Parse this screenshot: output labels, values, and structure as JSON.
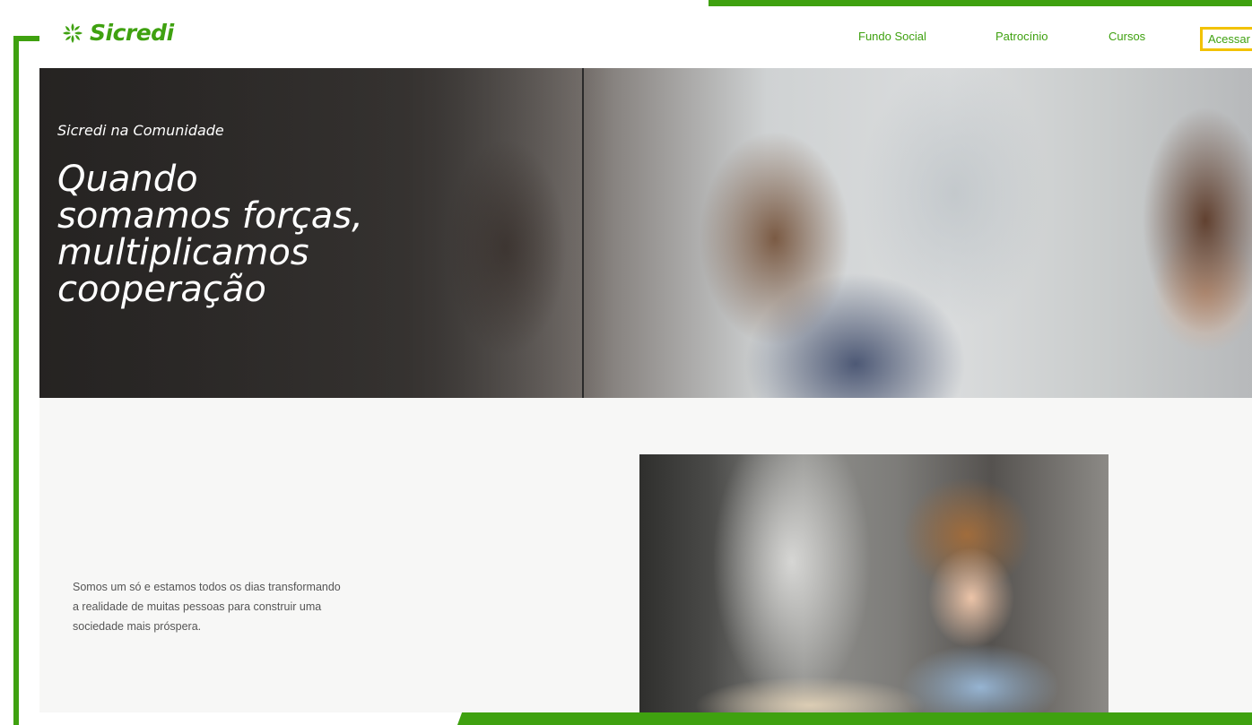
{
  "brand": {
    "name": "Sicredi",
    "color": "#3fa110"
  },
  "nav": {
    "items": [
      {
        "label": "Fundo Social"
      },
      {
        "label": "Patrocínio"
      },
      {
        "label": "Cursos"
      },
      {
        "label": "Acessar"
      }
    ]
  },
  "hero": {
    "eyebrow": "Sicredi na Comunidade",
    "title_lines": [
      "Quando",
      "somamos forças,",
      "multiplicamos",
      "cooperação"
    ]
  },
  "intro": {
    "lines": [
      "Somos um só e estamos todos os dias transformando",
      "a realidade de muitas pessoas para construir uma",
      "sociedade mais próspera."
    ]
  },
  "colors": {
    "highlight": "#f2c200",
    "frame": "#3fa110"
  }
}
